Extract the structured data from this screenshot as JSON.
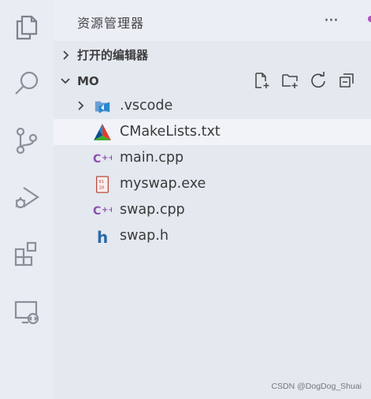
{
  "activity_bar": {
    "items": [
      {
        "name": "explorer",
        "icon": "files-icon",
        "active": true
      },
      {
        "name": "search",
        "icon": "search-icon"
      },
      {
        "name": "source-control",
        "icon": "source-control-icon"
      },
      {
        "name": "run-debug",
        "icon": "run-debug-icon"
      },
      {
        "name": "extensions",
        "icon": "extensions-icon"
      },
      {
        "name": "remote-explorer",
        "icon": "remote-explorer-icon"
      }
    ]
  },
  "explorer": {
    "title": "资源管理器",
    "more_label": "···",
    "open_editors": {
      "label": "打开的编辑器",
      "expanded": false
    },
    "workspace": {
      "label": "MO",
      "expanded": true,
      "actions": [
        "new-file-icon",
        "new-folder-icon",
        "refresh-icon",
        "collapse-all-icon"
      ]
    },
    "files": [
      {
        "label": ".vscode",
        "type": "folder",
        "icon": "vscode-folder-icon",
        "expanded": false
      },
      {
        "label": "CMakeLists.txt",
        "type": "file",
        "icon": "cmake-icon",
        "hovered": true
      },
      {
        "label": "main.cpp",
        "type": "file",
        "icon": "cpp-icon"
      },
      {
        "label": "myswap.exe",
        "type": "file",
        "icon": "binary-icon"
      },
      {
        "label": "swap.cpp",
        "type": "file",
        "icon": "cpp-icon"
      },
      {
        "label": "swap.h",
        "type": "file",
        "icon": "header-icon"
      }
    ]
  },
  "watermark": "CSDN @DogDog_Shuai",
  "colors": {
    "background": "#e4e8ef",
    "activity_icon": "#8a8f99",
    "cpp_purple": "#8a4fb0",
    "header_blue": "#2b6aa8",
    "vscode_blue": "#2a87d0"
  }
}
